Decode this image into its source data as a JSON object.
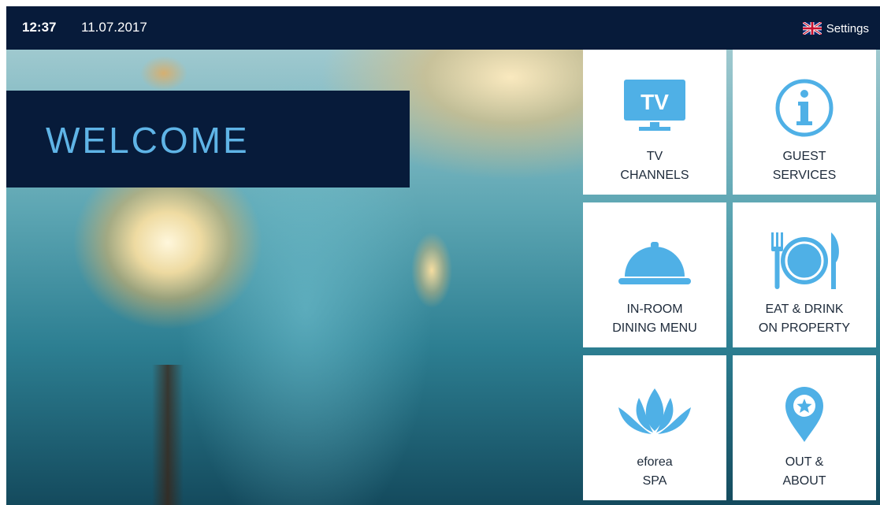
{
  "topbar": {
    "time": "12:37",
    "date": "11.07.2017",
    "settings_label": "Settings",
    "language_flag": "uk-flag-icon"
  },
  "welcome": {
    "title": "WELCOME"
  },
  "tiles": [
    {
      "icon": "tv-icon",
      "icon_text": "TV",
      "line1": "TV",
      "line2": "CHANNELS"
    },
    {
      "icon": "info-icon",
      "line1": "GUEST",
      "line2": "SERVICES"
    },
    {
      "icon": "cloche-icon",
      "line1": "IN-ROOM",
      "line2": "DINING MENU"
    },
    {
      "icon": "plate-cutlery-icon",
      "line1": "EAT & DRINK",
      "line2": "ON PROPERTY"
    },
    {
      "icon": "lotus-icon",
      "line1": "eforea",
      "line2": "SPA"
    },
    {
      "icon": "map-pin-star-icon",
      "line1": "OUT &",
      "line2": "ABOUT"
    }
  ],
  "colors": {
    "topbar_bg": "#071b3a",
    "accent_blue": "#5fb4e6",
    "icon_blue": "#4fb0e6",
    "tile_bg": "#ffffff",
    "tile_text": "#1d2a3a"
  }
}
